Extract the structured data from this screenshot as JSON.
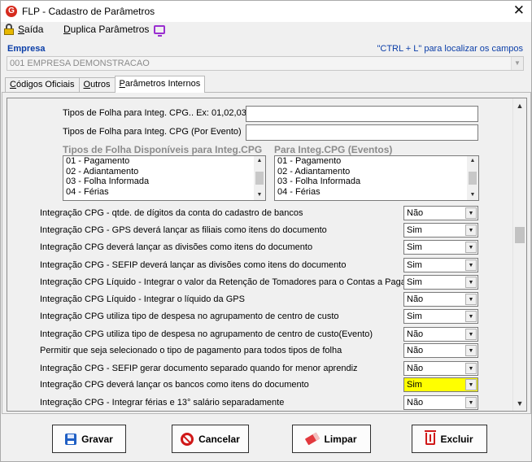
{
  "window": {
    "title": "FLP - Cadastro de Parâmetros",
    "app_icon_letter": "G",
    "close_glyph": "✕"
  },
  "menu": {
    "saida_first": "S",
    "saida_rest": "aída",
    "duplica_first": "D",
    "duplica_rest": "uplica Parâmetros"
  },
  "empresa": {
    "label": "Empresa",
    "hint": "\"CTRL + L\" para localizar os campos",
    "value": "001 EMPRESA DEMONSTRACAO"
  },
  "tabs": {
    "codigos_first": "C",
    "codigos_rest": "ódigos Oficiais",
    "outros_first": "O",
    "outros_rest": "utros",
    "internos_first": "P",
    "internos_rest": "arâmetros Internos"
  },
  "fields": {
    "tipos_folha_label": "Tipos de Folha para Integ. CPG.. Ex: 01,02,03",
    "tipos_folha_evento_label": "Tipos de Folha para Integ. CPG (Por Evento)"
  },
  "lists": {
    "disponiveis_title": "Tipos de Folha Disponíveis para Integ.CPG",
    "eventos_title": "Para Integ.CPG (Eventos)",
    "disponiveis_items": [
      "01 - Pagamento",
      "02 - Adiantamento",
      "03 - Folha Informada",
      "04 - Férias"
    ],
    "eventos_items": [
      "01 - Pagamento",
      "02 - Adiantamento",
      "03 - Folha Informada",
      "04 - Férias"
    ]
  },
  "params": [
    {
      "label": "Integração CPG - qtde. de dígitos da conta do cadastro de bancos",
      "value": "Não"
    },
    {
      "label": "Integração CPG - GPS deverá lançar as filiais como itens do documento",
      "value": "Sim"
    },
    {
      "label": "Integração CPG deverá lançar as divisões como itens do documento",
      "value": "Sim"
    },
    {
      "label": "Integração CPG - SEFIP deverá lançar as divisões como itens do documento",
      "value": "Sim"
    },
    {
      "label": "Integração CPG Líquido - Integrar o valor da Retenção de Tomadores para o Contas a Pagar",
      "value": "Sim"
    },
    {
      "label": "Integração CPG Líquido - Integrar o líquido da GPS",
      "value": "Não"
    },
    {
      "label": "Integração CPG utiliza tipo de despesa no agrupamento de centro de custo",
      "value": "Sim"
    },
    {
      "label": "Integração CPG utiliza tipo de despesa no agrupamento de centro de custo(Evento)",
      "value": "Não"
    },
    {
      "label": "Permitir que seja selecionado o tipo de pagamento para todos tipos de folha",
      "value": "Não"
    },
    {
      "label": "Integração CPG - SEFIP gerar documento separado quando for menor aprendiz",
      "value": "Não"
    },
    {
      "label": "Integração CPG deverá lançar os bancos como itens do documento",
      "value": "Sim"
    },
    {
      "label": "Integração CPG - Integrar férias e 13° salário separadamente",
      "value": "Não"
    }
  ],
  "buttons": {
    "gravar": "Gravar",
    "cancelar": "Cancelar",
    "limpar": "Limpar",
    "excluir": "Excluir"
  },
  "colors": {
    "highlight": "#ffff00",
    "label_blue": "#0b3ea8",
    "group_gray": "#8c8c8c"
  }
}
